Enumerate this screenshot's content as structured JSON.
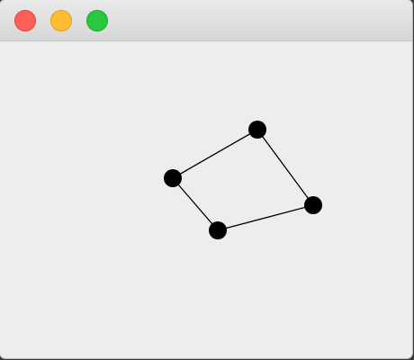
{
  "window": {
    "background": "#ededed",
    "traffic_lights": {
      "close_color": "#fe5f57",
      "close_border": "#e0443e",
      "minimize_color": "#febc2e",
      "minimize_border": "#dea123",
      "zoom_color": "#28c840",
      "zoom_border": "#1aab29"
    }
  },
  "canvas": {
    "vertex_color": "#000000",
    "edge_color": "#000000"
  }
}
